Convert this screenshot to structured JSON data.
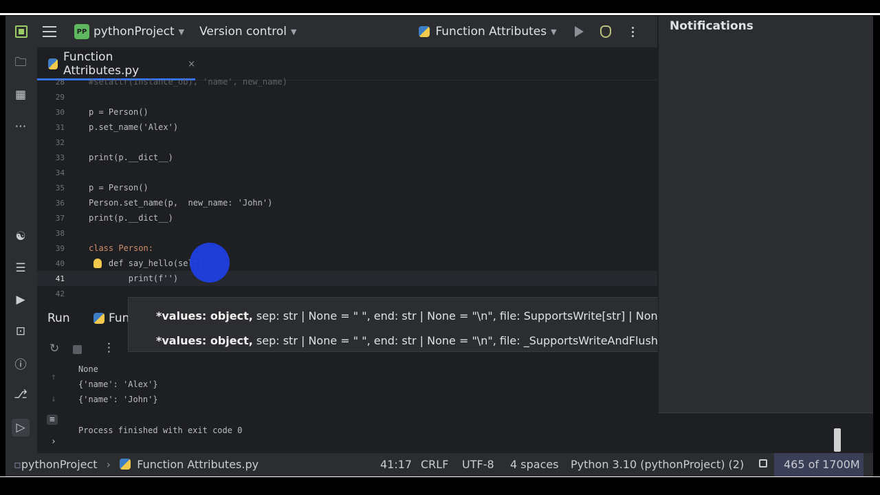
{
  "titlebar": {
    "project_badge": "PP",
    "project_name": "pythonProject",
    "vcs_label": "Version control",
    "run_config": "Function Attributes"
  },
  "tabs": [
    {
      "label": "Function Attributes.py",
      "close": "×"
    }
  ],
  "editor": {
    "current_line": 41,
    "lines": [
      {
        "num": "28",
        "text": "#setattr(instance_ob), 'name', new_name)"
      },
      {
        "num": "29",
        "text": ""
      },
      {
        "num": "30",
        "text": "p = Person()"
      },
      {
        "num": "31",
        "text": "p.set_name('Alex')"
      },
      {
        "num": "32",
        "text": ""
      },
      {
        "num": "33",
        "text": "print(p.__dict__)"
      },
      {
        "num": "34",
        "text": ""
      },
      {
        "num": "35",
        "text": "p = Person()"
      },
      {
        "num": "36",
        "text": "Person.set_name(p,  new_name: 'John')"
      },
      {
        "num": "37",
        "text": "print(p.__dict__)"
      },
      {
        "num": "38",
        "text": ""
      },
      {
        "num": "39",
        "text": "class Person:"
      },
      {
        "num": "40",
        "text": "    def say_hello(self):"
      },
      {
        "num": "41",
        "text": "        print(f'')"
      },
      {
        "num": "42",
        "text": ""
      }
    ],
    "hint": "new_name:"
  },
  "popup": {
    "row1": {
      "bold": "*values: object,",
      "rest": " sep: str | None = \" \", end: str | None = \"\\n\", file: SupportsWrite[str] | None ="
    },
    "row2": {
      "bold": "*values: object,",
      "rest": " sep: str | None = \" \", end: str | None = \"\\n\", file: _SupportsWriteAndFlush[str"
    }
  },
  "run": {
    "title": "Run",
    "tab_label": "Fun",
    "output": [
      "None",
      "{'name': 'Alex'}",
      "{'name': 'John'}",
      "",
      "Process finished with exit code 0"
    ]
  },
  "notifications": {
    "title": "Notifications"
  },
  "statusbar": {
    "breadcrumb_project": "pythonProject",
    "breadcrumb_file": "Function Attributes.py",
    "position": "41:17",
    "line_sep": "CRLF",
    "encoding": "UTF-8",
    "indent": "4 spaces",
    "interpreter": "Python 3.10 (pythonProject) (2)",
    "memory": "465 of 1700M"
  }
}
